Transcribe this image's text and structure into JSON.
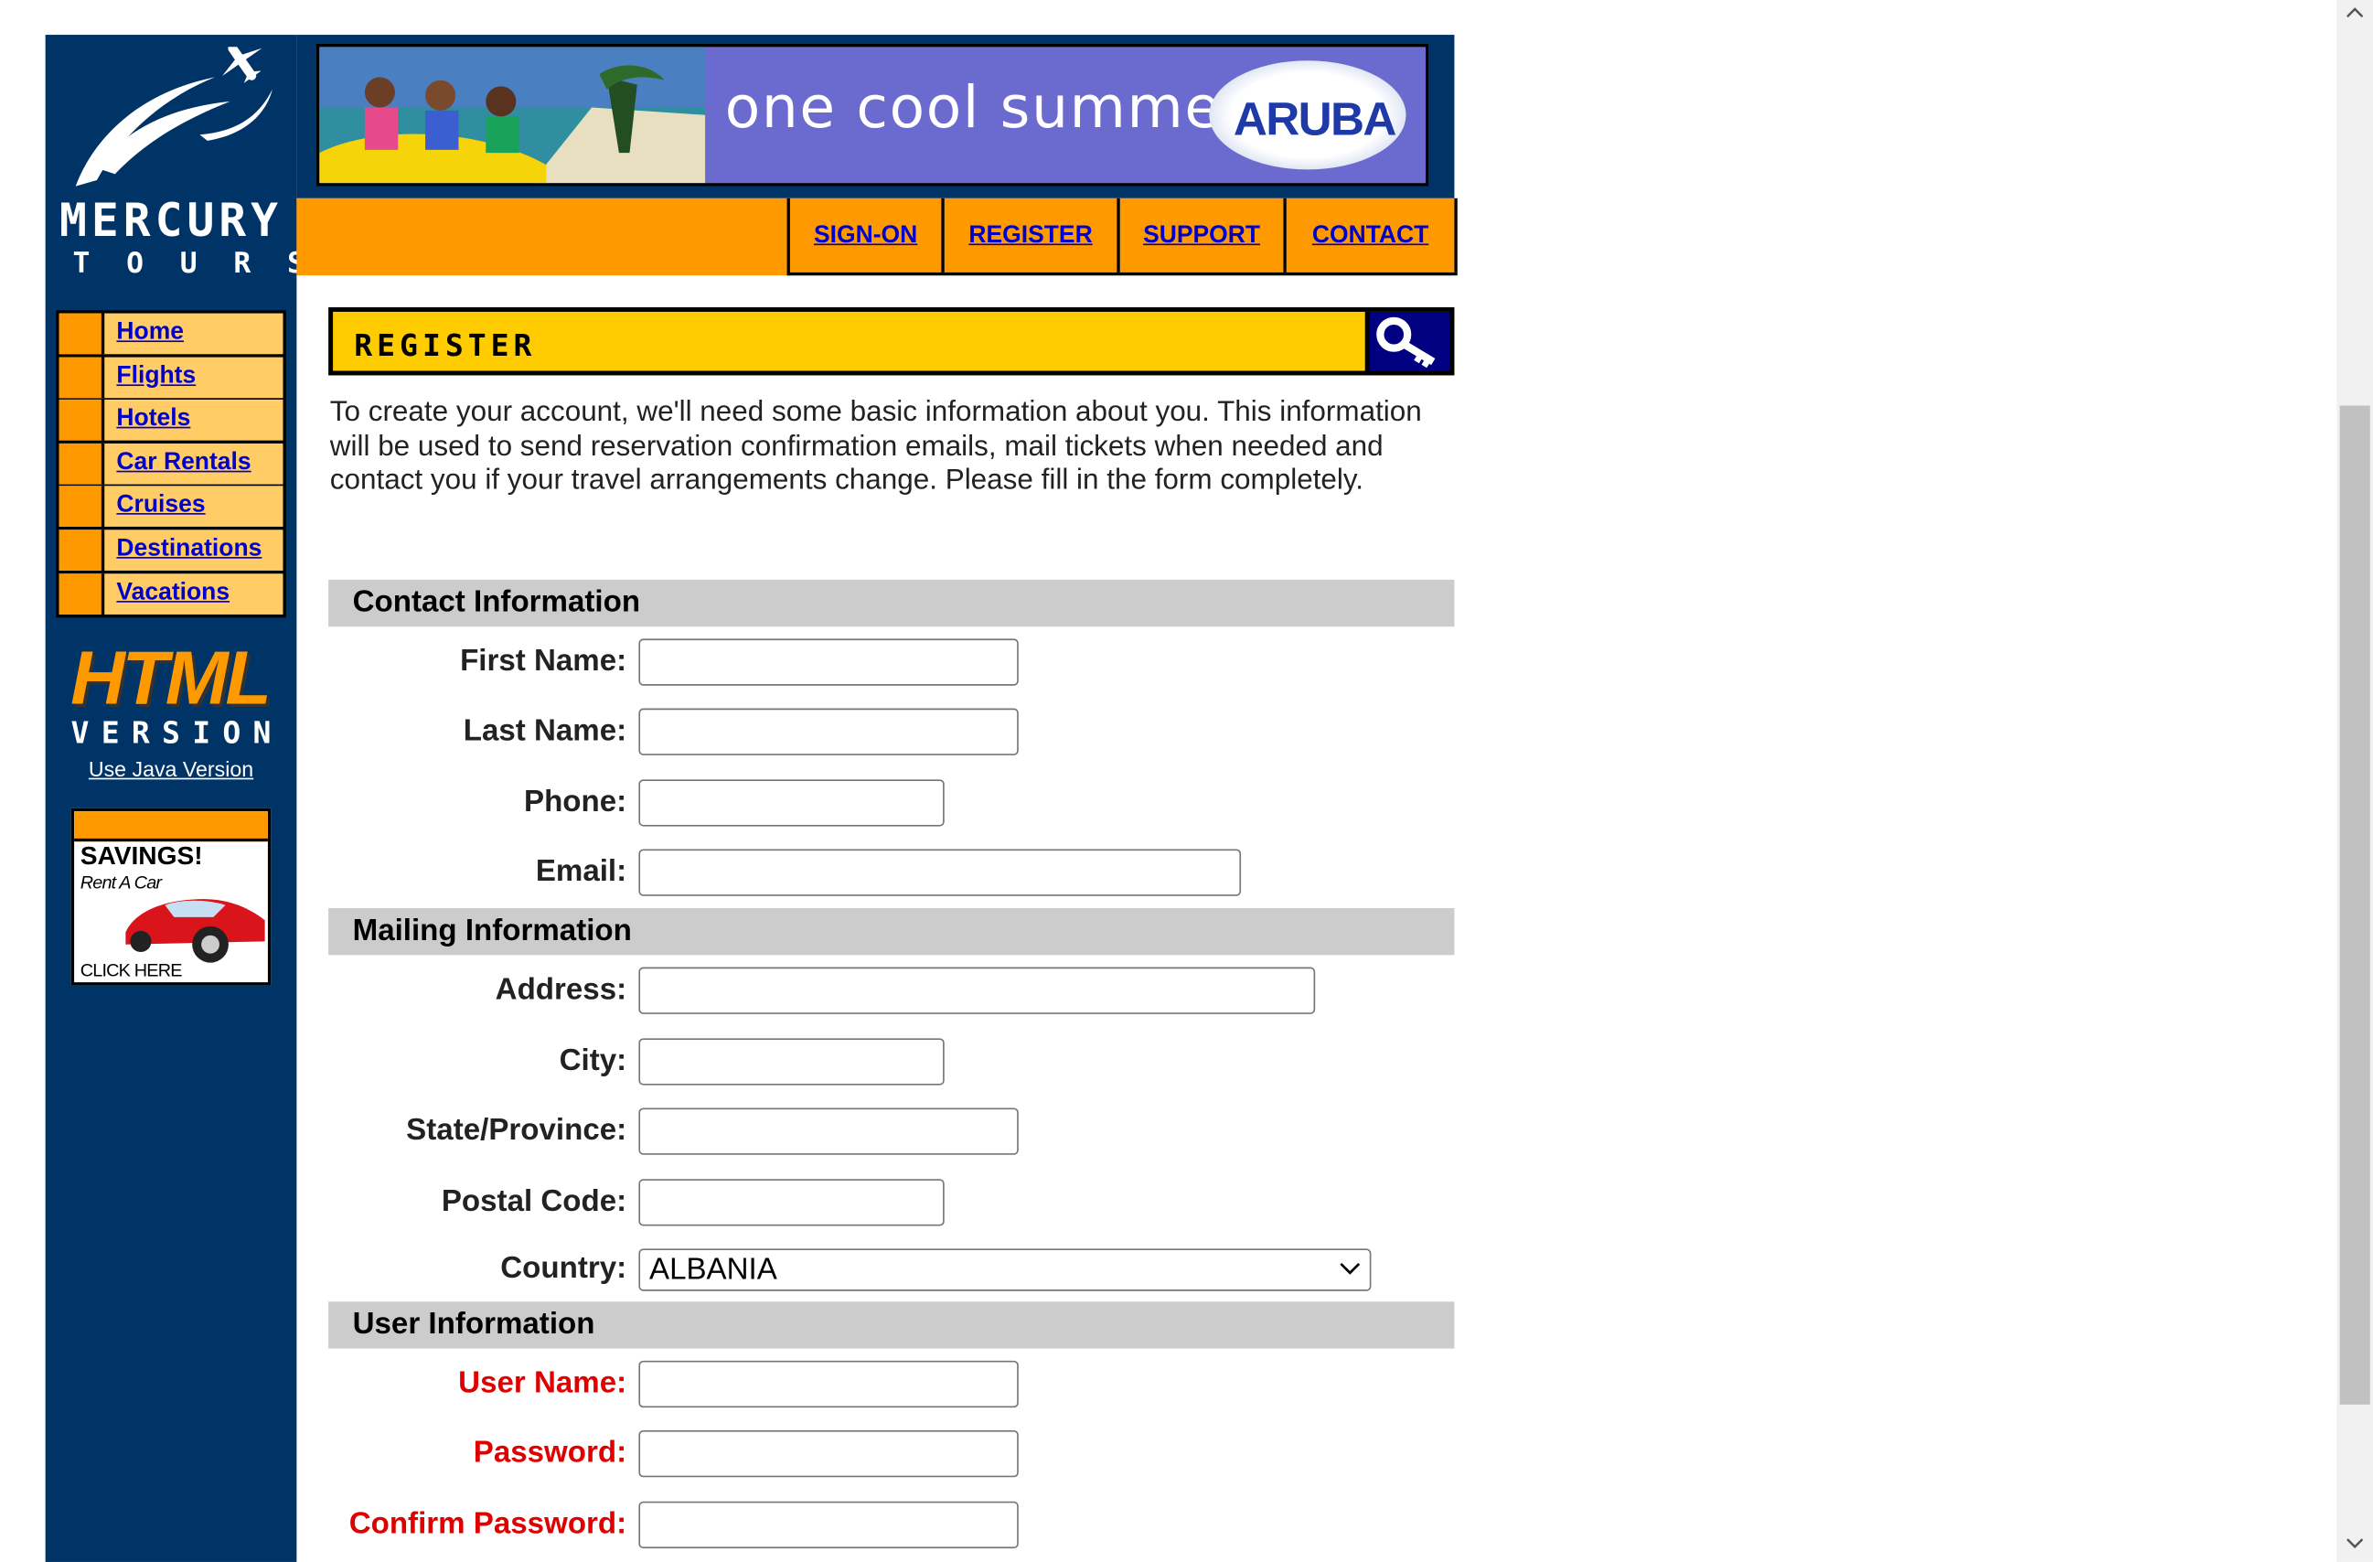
{
  "brand": {
    "name_line1": "MERCURY",
    "name_line2": "TOURS"
  },
  "banner": {
    "tagline": "one cool summer",
    "badge": "ARUBA"
  },
  "top_nav": [
    {
      "label": "SIGN-ON"
    },
    {
      "label": "REGISTER"
    },
    {
      "label": "SUPPORT"
    },
    {
      "label": "CONTACT"
    }
  ],
  "sidebar": {
    "items": [
      {
        "label": "Home"
      },
      {
        "label": "Flights"
      },
      {
        "label": "Hotels"
      },
      {
        "label": "Car Rentals"
      },
      {
        "label": "Cruises"
      },
      {
        "label": "Destinations"
      },
      {
        "label": "Vacations"
      }
    ],
    "html_version_line1": "HTML",
    "html_version_line2": "VERSION",
    "java_link": "Use Java Version",
    "ad": {
      "title": "SAVINGS!",
      "subtitle": "Rent A Car",
      "cta": "CLICK HERE"
    }
  },
  "page": {
    "title": "REGISTER",
    "intro": "To create your account, we'll need some basic information about you. This information will be used to send reservation confirmation emails, mail tickets when needed and contact you if your travel arrangements change. Please fill in the form completely."
  },
  "form": {
    "contact_section": "Contact Information",
    "first_name_label": "First Name:",
    "last_name_label": "Last Name:",
    "phone_label": "Phone:",
    "email_label": "Email:",
    "mailing_section": "Mailing Information",
    "address_label": "Address:",
    "city_label": "City:",
    "state_label": "State/Province:",
    "postal_label": "Postal Code:",
    "country_label": "Country:",
    "country_value": "ALBANIA",
    "user_section": "User Information",
    "username_label": "User Name:",
    "password_label": "Password:",
    "confirm_password_label": "Confirm Password:",
    "first_name_value": "",
    "last_name_value": "",
    "phone_value": "",
    "email_value": "",
    "address_value": "",
    "city_value": "",
    "state_value": "",
    "postal_value": "",
    "username_value": "",
    "password_value": "",
    "confirm_password_value": ""
  },
  "colors": {
    "sidebar_bg": "#003366",
    "accent_orange": "#ff9900",
    "header_yellow": "#ffcc00",
    "nav_item_bg": "#ffcc66",
    "link_blue": "#0000cc",
    "required_red": "#e00000"
  }
}
